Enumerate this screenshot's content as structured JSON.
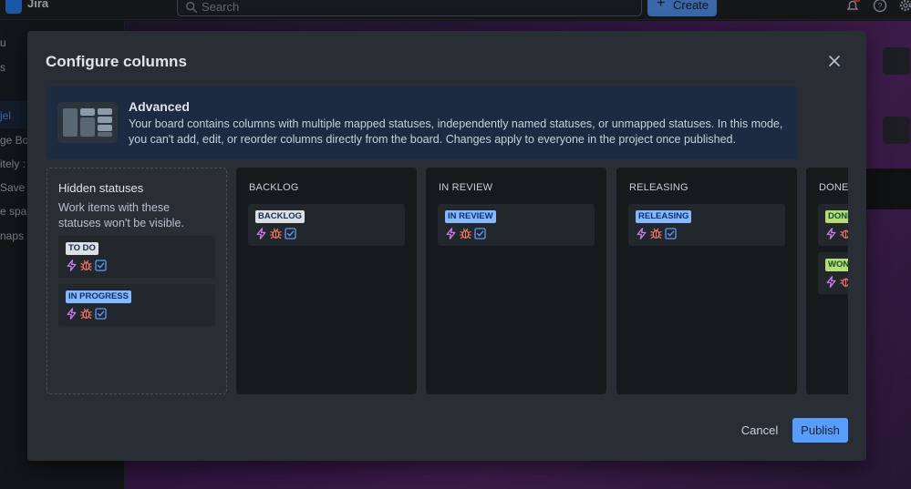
{
  "topbar": {
    "app_name": "Jira",
    "search_placeholder": "Search",
    "create_label": "Create"
  },
  "sidebar": {
    "items": [
      {
        "label": "u"
      },
      {
        "label": "s"
      },
      {
        "label": "jel"
      },
      {
        "label": "ge Bo"
      },
      {
        "label": "itely :"
      },
      {
        "label": "Save"
      },
      {
        "label": "e spac"
      },
      {
        "label": "naps"
      }
    ]
  },
  "modal": {
    "title": "Configure columns",
    "banner": {
      "title": "Advanced",
      "text": "Your board contains columns with multiple mapped statuses, independently named statuses, or unmapped statuses. In this mode, you can't add, edit, or reorder columns directly from the board. Changes apply to everyone in the project once published."
    },
    "hidden": {
      "title": "Hidden statuses",
      "description": "Work items with these statuses won't be visible.",
      "cards": [
        {
          "status": "TO DO",
          "tone": "gray"
        },
        {
          "status": "IN PROGRESS",
          "tone": "blue"
        }
      ]
    },
    "columns": [
      {
        "title": "BACKLOG",
        "cards": [
          {
            "status": "BACKLOG",
            "tone": "gray"
          }
        ]
      },
      {
        "title": "IN REVIEW",
        "cards": [
          {
            "status": "IN REVIEW",
            "tone": "blue"
          }
        ]
      },
      {
        "title": "RELEASING",
        "cards": [
          {
            "status": "RELEASING",
            "tone": "blue"
          }
        ]
      },
      {
        "title": "DONE",
        "cards": [
          {
            "status": "DONE",
            "tone": "green"
          },
          {
            "status": "WON'T DO",
            "tone": "green"
          }
        ]
      }
    ],
    "card_icons": [
      "epic-icon",
      "bug-icon",
      "task-icon"
    ],
    "cancel_label": "Cancel",
    "publish_label": "Publish"
  },
  "colors": {
    "accent": "#579dff",
    "epic": "#c97cf4",
    "bug": "#f87462",
    "task": "#579dff",
    "banner_bg": "#1c2b41",
    "modal_bg": "#282e33"
  }
}
